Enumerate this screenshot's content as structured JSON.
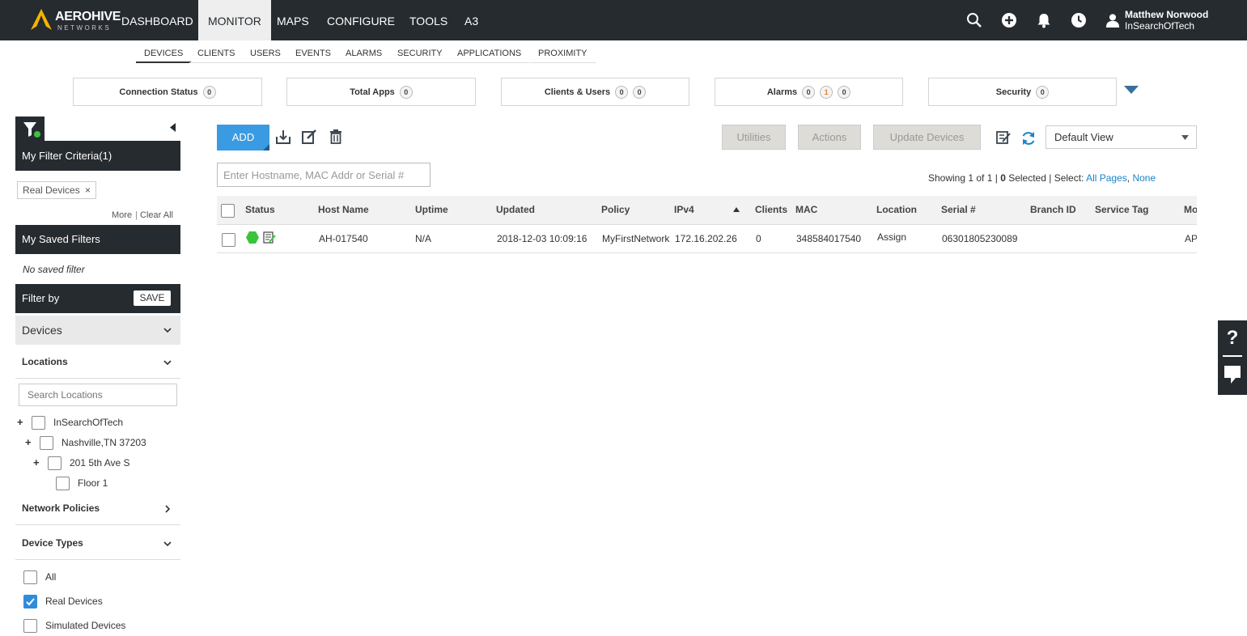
{
  "brand": {
    "name": "AEROHIVE",
    "sub": "NETWORKS",
    "logo_color": "#f5b400"
  },
  "nav": {
    "items": [
      "DASHBOARD",
      "MONITOR",
      "MAPS",
      "CONFIGURE",
      "TOOLS",
      "A3"
    ],
    "active": "MONITOR"
  },
  "user": {
    "name": "Matthew Norwood",
    "org": "InSearchOfTech"
  },
  "top_icons": [
    "search-icon",
    "add-circle-icon",
    "bell-icon",
    "clock-icon",
    "user-icon"
  ],
  "subnav": {
    "items": [
      "DEVICES",
      "CLIENTS",
      "USERS",
      "EVENTS",
      "ALARMS",
      "SECURITY",
      "APPLICATIONS",
      "PROXIMITY"
    ],
    "active": "DEVICES"
  },
  "stats": [
    {
      "label": "Connection Status",
      "badges": [
        "0"
      ]
    },
    {
      "label": "Total Apps",
      "badges": [
        "0"
      ]
    },
    {
      "label": "Clients & Users",
      "badges": [
        "0",
        "0"
      ]
    },
    {
      "label": "Alarms",
      "badges": [
        "0",
        "1",
        "0"
      ]
    },
    {
      "label": "Security",
      "badges": [
        "0"
      ]
    }
  ],
  "sidebar": {
    "filter_criteria": "My Filter Criteria(1)",
    "chip": "Real Devices",
    "more": "More",
    "clear_all": "Clear All",
    "saved_filters": "My Saved Filters",
    "no_saved": "No saved filter",
    "filter_by": "Filter by",
    "save": "SAVE",
    "devices": "Devices",
    "locations": "Locations",
    "search_locations_placeholder": "Search Locations",
    "tree": [
      "InSearchOfTech",
      "Nashville,TN 37203",
      "201 5th Ave S",
      "Floor 1"
    ],
    "network_policies": "Network Policies",
    "device_types": "Device Types",
    "types": [
      {
        "label": "All",
        "checked": false
      },
      {
        "label": "Real Devices",
        "checked": true
      },
      {
        "label": "Simulated Devices",
        "checked": false
      }
    ]
  },
  "toolbar": {
    "add": "ADD",
    "utilities": "Utilities",
    "actions": "Actions",
    "update_devices": "Update Devices",
    "view": "Default View",
    "search_placeholder": "Enter Hostname, MAC Addr or Serial #"
  },
  "showing": {
    "prefix": "Showing 1 of 1 | ",
    "selected": "0",
    "suffix": " Selected | Select: ",
    "all_pages": "All Pages",
    "none": "None"
  },
  "table": {
    "columns": [
      "Status",
      "Host Name",
      "Uptime",
      "Updated",
      "Policy",
      "IPv4",
      "Clients",
      "MAC",
      "Location",
      "Serial #",
      "Branch ID",
      "Service Tag",
      "Mo"
    ],
    "rows": [
      {
        "host": "AH-017540",
        "uptime": "N/A",
        "updated": "2018-12-03 10:09:16",
        "policy": "MyFirstNetwork",
        "ipv4": "172.16.202.26",
        "clients": "0",
        "mac": "348584017540",
        "location": "Assign",
        "serial": "06301805230089",
        "branch": "",
        "service_tag": "",
        "model": "AP"
      }
    ]
  },
  "colors": {
    "dark": "#262b30",
    "accent": "#3a9be3",
    "link": "#1a84c8",
    "status_ok": "#3ac43a"
  }
}
